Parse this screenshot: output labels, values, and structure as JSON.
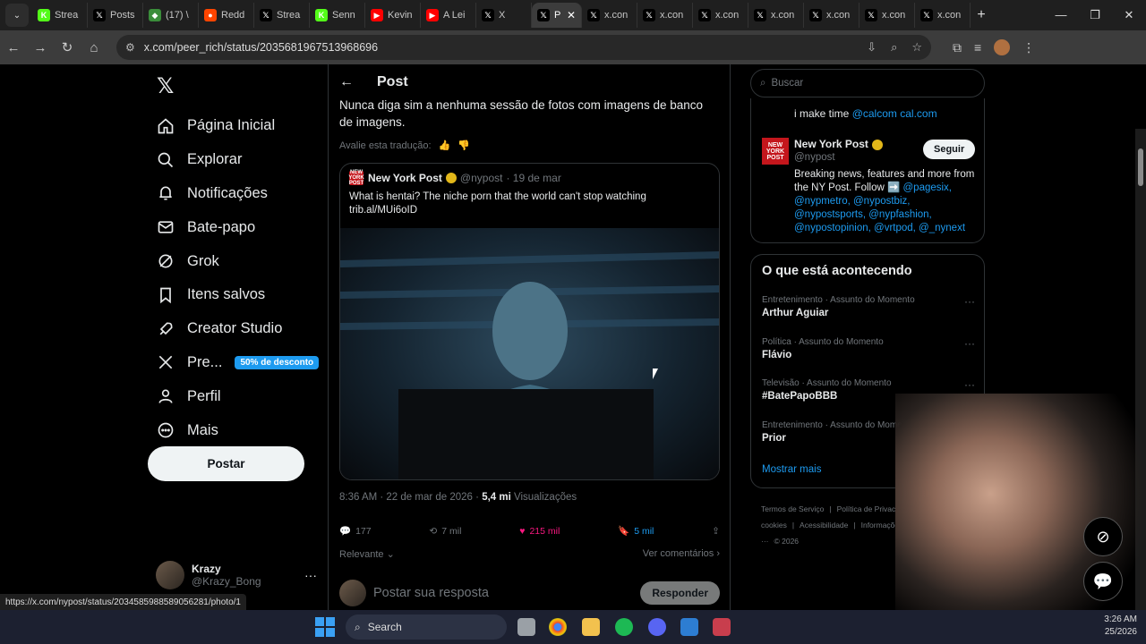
{
  "browser": {
    "tabs": [
      {
        "label": "Strea",
        "icon": "kick-icon",
        "color": "#53fc18"
      },
      {
        "label": "Posts",
        "icon": "x-icon",
        "color": "#000000"
      },
      {
        "label": "(17) \\",
        "icon": "app-icon",
        "color": "#3a8d3a"
      },
      {
        "label": "Redd",
        "icon": "reddit-icon",
        "color": "#ff4500"
      },
      {
        "label": "Strea",
        "icon": "x-icon",
        "color": "#000000"
      },
      {
        "label": "Senn",
        "icon": "kick-icon",
        "color": "#53fc18"
      },
      {
        "label": "Kevin",
        "icon": "youtube-icon",
        "color": "#ff0000"
      },
      {
        "label": "A Lei",
        "icon": "youtube-icon",
        "color": "#ff0000"
      },
      {
        "label": "X",
        "icon": "x-icon",
        "color": "#000000"
      },
      {
        "label": "P",
        "icon": "x-icon",
        "color": "#000000",
        "active": true
      },
      {
        "label": "x.con",
        "icon": "x-icon",
        "color": "#000000"
      },
      {
        "label": "x.con",
        "icon": "x-icon",
        "color": "#000000"
      },
      {
        "label": "x.con",
        "icon": "x-icon",
        "color": "#000000"
      },
      {
        "label": "x.con",
        "icon": "x-icon",
        "color": "#000000"
      },
      {
        "label": "x.con",
        "icon": "x-icon",
        "color": "#000000"
      },
      {
        "label": "x.con",
        "icon": "x-icon",
        "color": "#000000"
      },
      {
        "label": "x.con",
        "icon": "x-icon",
        "color": "#000000"
      }
    ],
    "url": "x.com/peer_rich/status/2035681967513968696",
    "status_url": "https://x.com/nypost/status/2034585988589056281/photo/1"
  },
  "sidebar": {
    "items": [
      {
        "label": "Página Inicial",
        "icon": "home-icon"
      },
      {
        "label": "Explorar",
        "icon": "search-icon"
      },
      {
        "label": "Notificações",
        "icon": "bell-icon"
      },
      {
        "label": "Bate-papo",
        "icon": "mail-icon"
      },
      {
        "label": "Grok",
        "icon": "grok-icon"
      },
      {
        "label": "Itens salvos",
        "icon": "bookmark-icon"
      },
      {
        "label": "Creator Studio",
        "icon": "rocket-icon"
      },
      {
        "label": "Pre...",
        "icon": "x-icon",
        "badge": "50% de desconto"
      },
      {
        "label": "Perfil",
        "icon": "person-icon"
      },
      {
        "label": "Mais",
        "icon": "more-circle-icon"
      }
    ],
    "post_button": "Postar",
    "user": {
      "name": "Krazy",
      "handle": "@Krazy_Bong"
    }
  },
  "post": {
    "header": "Post",
    "translated_text": "Nunca diga sim a nenhuma sessão de fotos com imagens de banco de imagens.",
    "rate_translation": "Avalie esta tradução:",
    "quote": {
      "name": "New York Post",
      "handle": "@nypost",
      "date": "· 19 de mar",
      "text": "What is hentai? The niche porn that the world can't stop watching trib.al/MUi6oID"
    },
    "timestamp": "8:36 AM · 22 de mar de 2026 ·",
    "views_count": "5,4 mi",
    "views_label": "Visualizações",
    "stats": {
      "replies": "177",
      "reposts": "7 mil",
      "likes": "215 mil",
      "bookmarks": "5 mil"
    },
    "sort_label": "Relevante",
    "view_quotes": "Ver comentários",
    "reply_placeholder": "Postar sua resposta",
    "reply_button": "Responder"
  },
  "right": {
    "search_placeholder": "Buscar",
    "prev_account_bio": "i make time",
    "prev_account_link": "@calcom cal.com",
    "account": {
      "name": "New York Post",
      "handle": "@nypost",
      "follow": "Seguir",
      "bio": "Breaking news, features and more from the NY Post. Follow ➡️",
      "bio_links": "@pagesix, @nypmetro, @nypostbiz, @nypostsports, @nypfashion, @nypostopinion, @vrtpod, @_nynext"
    },
    "trends_title": "O que está acontecendo",
    "trends": [
      {
        "category": "Entretenimento · Assunto do Momento",
        "name": "Arthur Aguiar"
      },
      {
        "category": "Política · Assunto do Momento",
        "name": "Flávio"
      },
      {
        "category": "Televisão · Assunto do Momento",
        "name": "#BatePapoBBB"
      },
      {
        "category": "Entretenimento · Assunto do Momento",
        "name": "Prior"
      }
    ],
    "show_more": "Mostrar mais",
    "footer": [
      "Termos de Serviço",
      "|",
      "Política de Privacidade",
      "|",
      "Política de cookies",
      "|",
      "Acessibilidade",
      "|",
      "Informações de anúncios",
      "|",
      "Mais ···",
      "© 2026"
    ]
  },
  "taskbar": {
    "search": "Search",
    "time": "3:26 AM",
    "date": "25/2026"
  }
}
